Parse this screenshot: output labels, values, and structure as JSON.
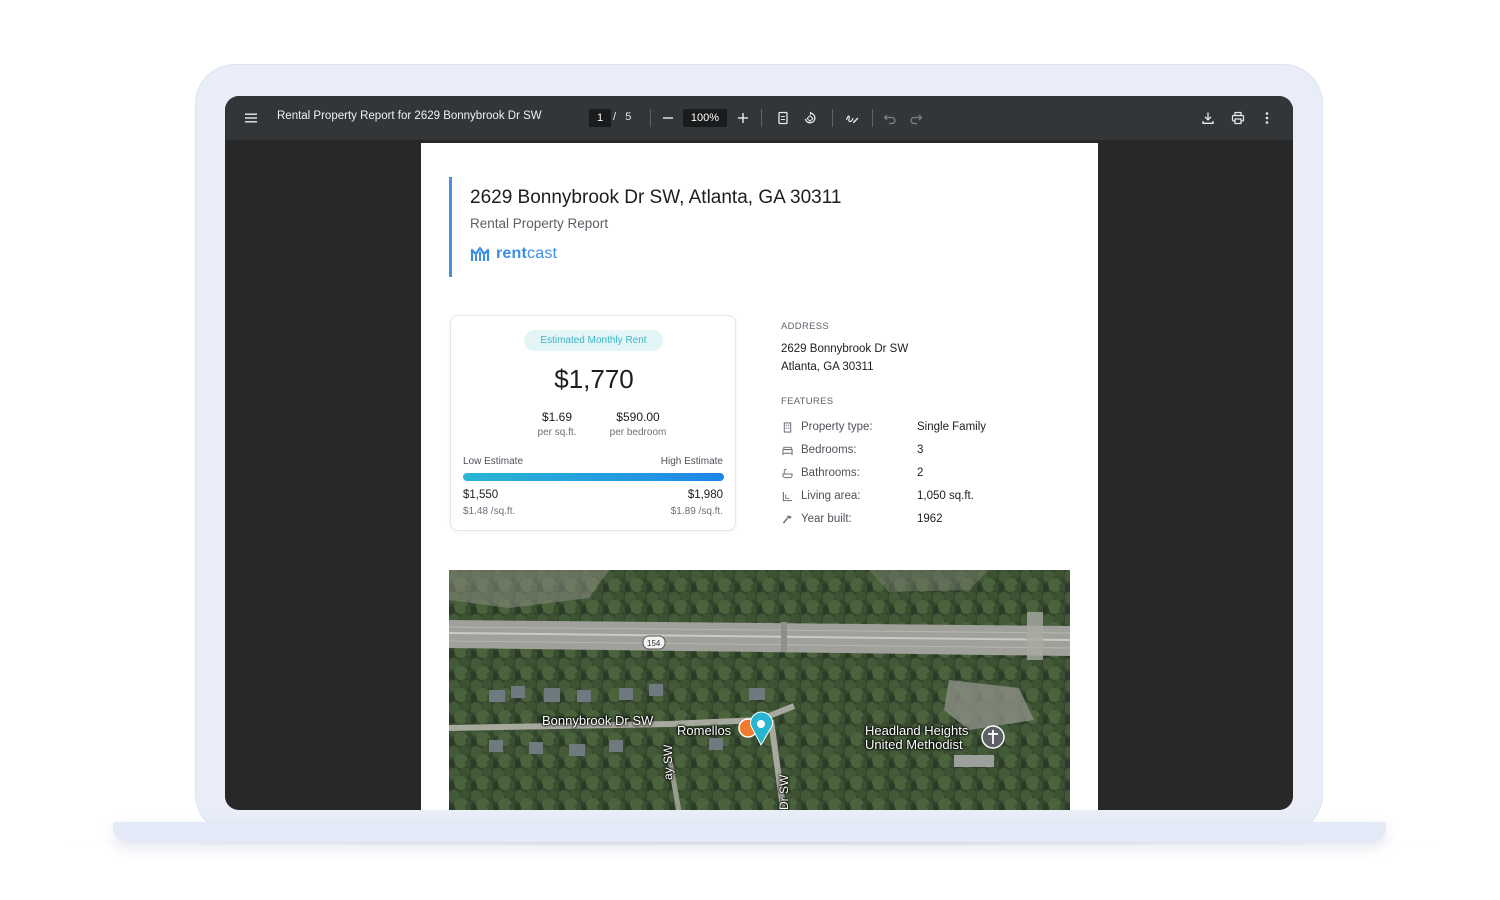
{
  "toolbar": {
    "menu_icon": "menu-icon",
    "title": "Rental Property Report for 2629 Bonnybrook Dr SW",
    "current_page": "1",
    "page_separator": "/",
    "total_pages": "5",
    "zoom": "100%",
    "icons": [
      "zoom-out-icon",
      "zoom-in-icon",
      "fit-page-icon",
      "rotate-icon",
      "annotate-icon",
      "undo-icon",
      "redo-icon",
      "download-icon",
      "print-icon",
      "more-icon"
    ]
  },
  "report": {
    "title": "2629 Bonnybrook Dr SW, Atlanta, GA 30311",
    "subtitle": "Rental Property Report",
    "logo_text_bold": "rent",
    "logo_text_regular": "cast",
    "accent_color": "#3a8ee6"
  },
  "rent_card": {
    "badge": "Estimated Monthly Rent",
    "value": "$1,770",
    "per_sqft_value": "$1.69",
    "per_sqft_label": "per sq.ft.",
    "per_bedroom_value": "$590.00",
    "per_bedroom_label": "per bedroom",
    "low_label": "Low Estimate",
    "high_label": "High Estimate",
    "low_value": "$1,550",
    "low_sub": "$1.48 /sq.ft.",
    "high_value": "$1,980",
    "high_sub": "$1.89 /sq.ft."
  },
  "address_section": {
    "label": "ADDRESS",
    "line1": "2629 Bonnybrook Dr SW",
    "line2": "Atlanta, GA 30311"
  },
  "features_section": {
    "label": "FEATURES",
    "rows": [
      {
        "icon": "building-icon",
        "label": "Property type:",
        "value": "Single Family"
      },
      {
        "icon": "bed-icon",
        "label": "Bedrooms:",
        "value": "3"
      },
      {
        "icon": "bath-icon",
        "label": "Bathrooms:",
        "value": "2"
      },
      {
        "icon": "area-icon",
        "label": "Living area:",
        "value": "1,050 sq.ft."
      },
      {
        "icon": "hammer-icon",
        "label": "Year built:",
        "value": "1962"
      }
    ]
  },
  "map": {
    "labels": {
      "street_main": "Bonnybrook Dr SW",
      "poi_restaurant": "Romellos",
      "poi_church_line1": "Headland Heights",
      "poi_church_line2": "United Methodist",
      "highway_shield": "154",
      "street_vertical_left": "ay SW",
      "street_vertical_right": "Dr SW"
    }
  }
}
